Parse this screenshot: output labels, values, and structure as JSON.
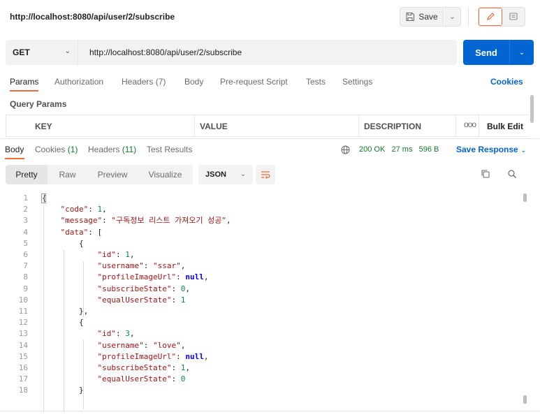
{
  "header": {
    "title": "http://localhost:8080/api/user/2/subscribe",
    "save_label": "Save"
  },
  "request": {
    "method": "GET",
    "url": "http://localhost:8080/api/user/2/subscribe",
    "send_label": "Send"
  },
  "request_tabs": [
    {
      "label": "Params"
    },
    {
      "label": "Authorization"
    },
    {
      "label": "Headers (7)"
    },
    {
      "label": "Body"
    },
    {
      "label": "Pre-request Script"
    },
    {
      "label": "Tests"
    },
    {
      "label": "Settings"
    }
  ],
  "cookies_label": "Cookies",
  "query_params": {
    "title": "Query Params",
    "columns": [
      "KEY",
      "VALUE",
      "DESCRIPTION"
    ],
    "more": "ooo",
    "bulk_edit": "Bulk Edit"
  },
  "response_tabs": {
    "body": "Body",
    "cookies": "Cookies",
    "cookies_count": "(1)",
    "headers": "Headers",
    "headers_count": "(11)",
    "test_results": "Test Results"
  },
  "response_status": {
    "status": "200 OK",
    "time": "27 ms",
    "size": "596 B",
    "save_response": "Save Response"
  },
  "view_modes": [
    "Pretty",
    "Raw",
    "Preview",
    "Visualize"
  ],
  "format": "JSON",
  "colors": {
    "accent": "#f26b3a",
    "primary": "#0265d2",
    "success": "#0f7b2c"
  },
  "code_lines": [
    {
      "n": "1",
      "text": "{"
    },
    {
      "n": "2",
      "text": "    \"code\": 1,"
    },
    {
      "n": "3",
      "text": "    \"message\": \"구독정보 리스트 가져오기 성공\","
    },
    {
      "n": "4",
      "text": "    \"data\": ["
    },
    {
      "n": "5",
      "text": "        {"
    },
    {
      "n": "6",
      "text": "            \"id\": 1,"
    },
    {
      "n": "7",
      "text": "            \"username\": \"ssar\","
    },
    {
      "n": "8",
      "text": "            \"profileImageUrl\": null,"
    },
    {
      "n": "9",
      "text": "            \"subscribeState\": 0,"
    },
    {
      "n": "10",
      "text": "            \"equalUserState\": 1"
    },
    {
      "n": "11",
      "text": "        },"
    },
    {
      "n": "12",
      "text": "        {"
    },
    {
      "n": "13",
      "text": "            \"id\": 3,"
    },
    {
      "n": "14",
      "text": "            \"username\": \"love\","
    },
    {
      "n": "15",
      "text": "            \"profileImageUrl\": null,"
    },
    {
      "n": "16",
      "text": "            \"subscribeState\": 1,"
    },
    {
      "n": "17",
      "text": "            \"equalUserState\": 0"
    },
    {
      "n": "18",
      "text": "        }"
    }
  ]
}
